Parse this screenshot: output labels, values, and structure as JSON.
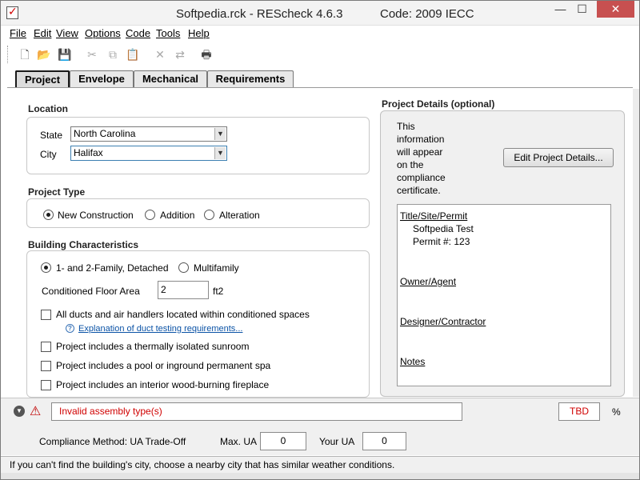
{
  "window": {
    "title": "Softpedia.rck - REScheck 4.6.3",
    "code_label": "Code: 2009 IECC",
    "minimize_glyph": "—",
    "maximize_glyph": "☐",
    "close_glyph": "✕"
  },
  "menu": {
    "items": [
      "File",
      "Edit",
      "View",
      "Options",
      "Code",
      "Tools",
      "Help"
    ]
  },
  "toolbar": {
    "icons": [
      "new-document-icon",
      "open-folder-icon",
      "save-icon",
      "cut-icon",
      "copy-icon",
      "paste-icon",
      "delete-icon",
      "replace-icon",
      "print-icon"
    ],
    "glyphs": [
      "🗋",
      "📂",
      "💾",
      "✂",
      "⧉",
      "📋",
      "✕",
      "⇄",
      "🖶"
    ]
  },
  "tabs": {
    "items": [
      "Project",
      "Envelope",
      "Mechanical",
      "Requirements"
    ],
    "active": "Project"
  },
  "location": {
    "section_title": "Location",
    "state_label": "State",
    "state_value": "North Carolina",
    "city_label": "City",
    "city_value": "Halifax"
  },
  "project_type": {
    "section_title": "Project Type",
    "options": [
      "New Construction",
      "Addition",
      "Alteration"
    ],
    "selected": "New Construction"
  },
  "building": {
    "section_title": "Building Characteristics",
    "types": [
      "1- and 2-Family, Detached",
      "Multifamily"
    ],
    "selected_type": "1- and 2-Family, Detached",
    "floor_area_label": "Conditioned Floor Area",
    "floor_area_value": "2",
    "floor_area_unit": "ft2",
    "ducts_label": "All ducts and air handlers located within conditioned spaces",
    "ducts_checked": false,
    "duct_link": "Explanation of duct testing requirements...",
    "sunroom_label": "Project includes a thermally isolated sunroom",
    "sunroom_checked": false,
    "pool_label": "Project includes a pool or inground permanent spa",
    "pool_checked": false,
    "fireplace_label": "Project includes an interior wood-burning fireplace",
    "fireplace_checked": false
  },
  "project_details": {
    "section_title": "Project Details (optional)",
    "info_lines": [
      "This",
      "information",
      " will appear",
      "on the",
      "compliance",
      " certificate."
    ],
    "edit_button": "Edit Project Details...",
    "title_heading": "Title/Site/Permit",
    "title_line1": "Softpedia Test",
    "title_line2": "Permit #: 123",
    "owner_heading": "Owner/Agent",
    "designer_heading": "Designer/Contractor",
    "notes_heading": "Notes"
  },
  "messages": {
    "error_text": "Invalid assembly type(s)",
    "tbd_value": "TBD",
    "percent_symbol": "%"
  },
  "compliance": {
    "method_label": "Compliance Method: UA Trade-Off",
    "max_ua_label": "Max. UA",
    "max_ua_value": "0",
    "your_ua_label": "Your UA",
    "your_ua_value": "0"
  },
  "status_bar": {
    "text": "If you can't find the building's city, choose a nearby city that has similar weather conditions."
  }
}
